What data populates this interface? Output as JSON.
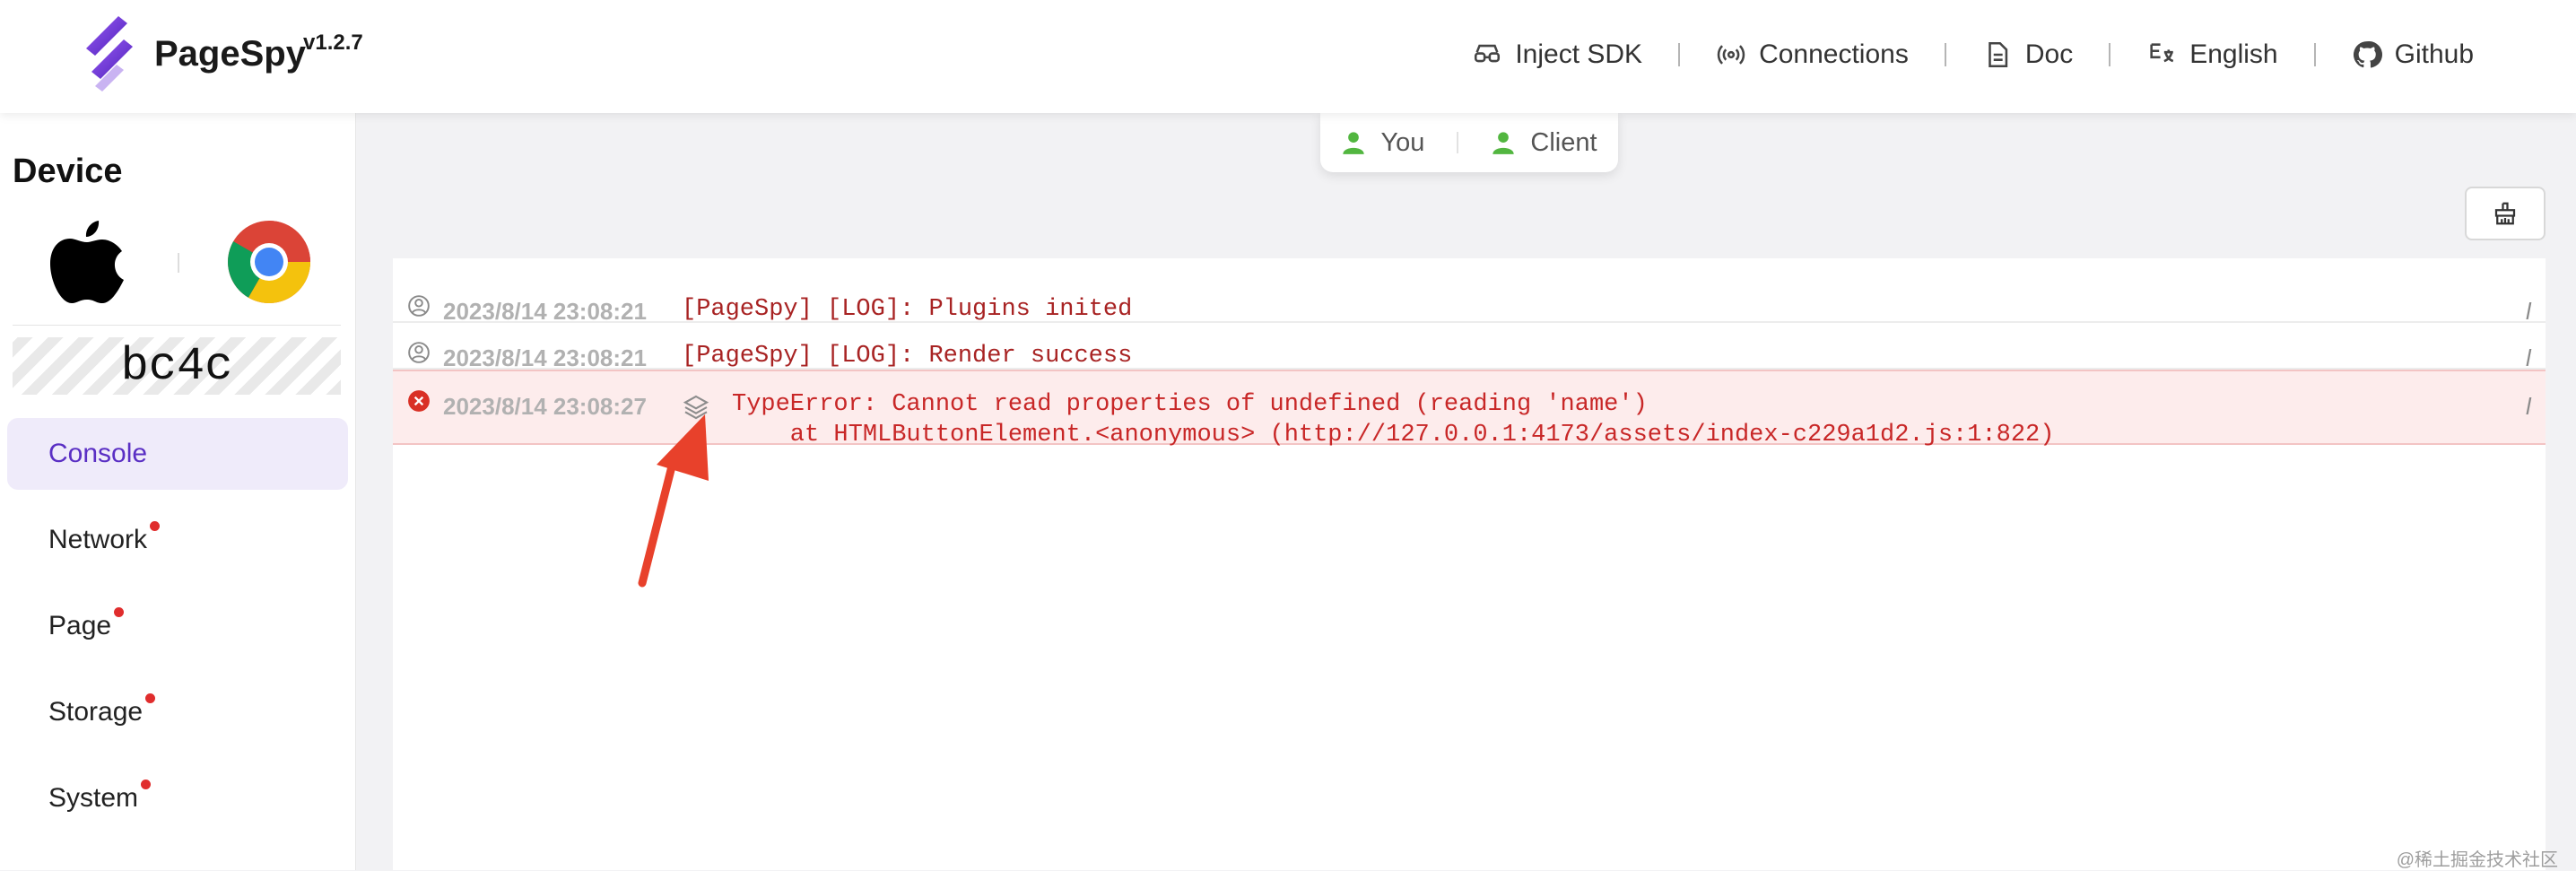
{
  "header": {
    "brand": "PageSpy",
    "version": "v1.2.7",
    "nav": [
      {
        "label": "Inject SDK",
        "icon": "glasses-icon"
      },
      {
        "label": "Connections",
        "icon": "signal-icon"
      },
      {
        "label": "Doc",
        "icon": "document-icon"
      },
      {
        "label": "English",
        "icon": "translate-icon"
      },
      {
        "label": "Github",
        "icon": "github-icon"
      }
    ]
  },
  "sidebar": {
    "title": "Device",
    "os_icon": "apple-icon",
    "browser_icon": "chrome-icon",
    "device_id": "bc4c",
    "menu": [
      {
        "label": "Console",
        "active": true,
        "dot": false
      },
      {
        "label": "Network",
        "active": false,
        "dot": true
      },
      {
        "label": "Page",
        "active": false,
        "dot": true
      },
      {
        "label": "Storage",
        "active": false,
        "dot": true
      },
      {
        "label": "System",
        "active": false,
        "dot": true
      }
    ]
  },
  "roles": [
    "You",
    "Client"
  ],
  "console": {
    "logs": [
      {
        "level": "log",
        "time": "2023/8/14 23:08:21",
        "message": "[PageSpy] [LOG]: Plugins inited",
        "source": "l"
      },
      {
        "level": "log",
        "time": "2023/8/14 23:08:21",
        "message": "[PageSpy] [LOG]: Render success",
        "source": "l"
      },
      {
        "level": "error",
        "time": "2023/8/14 23:08:27",
        "message": "TypeError: Cannot read properties of undefined (reading 'name')",
        "stack": "    at HTMLButtonElement.<anonymous> (http://127.0.0.1:4173/assets/index-c229a1d2.js:1:822)",
        "source": "l"
      }
    ]
  },
  "colors": {
    "accent": "#5a2fc4",
    "error_text": "#c82727",
    "log_text": "#a82323",
    "status_dot": "#e02d2d",
    "role_icon": "#52b640",
    "arrow": "#e8412b"
  },
  "watermark": "@稀土掘金技术社区"
}
